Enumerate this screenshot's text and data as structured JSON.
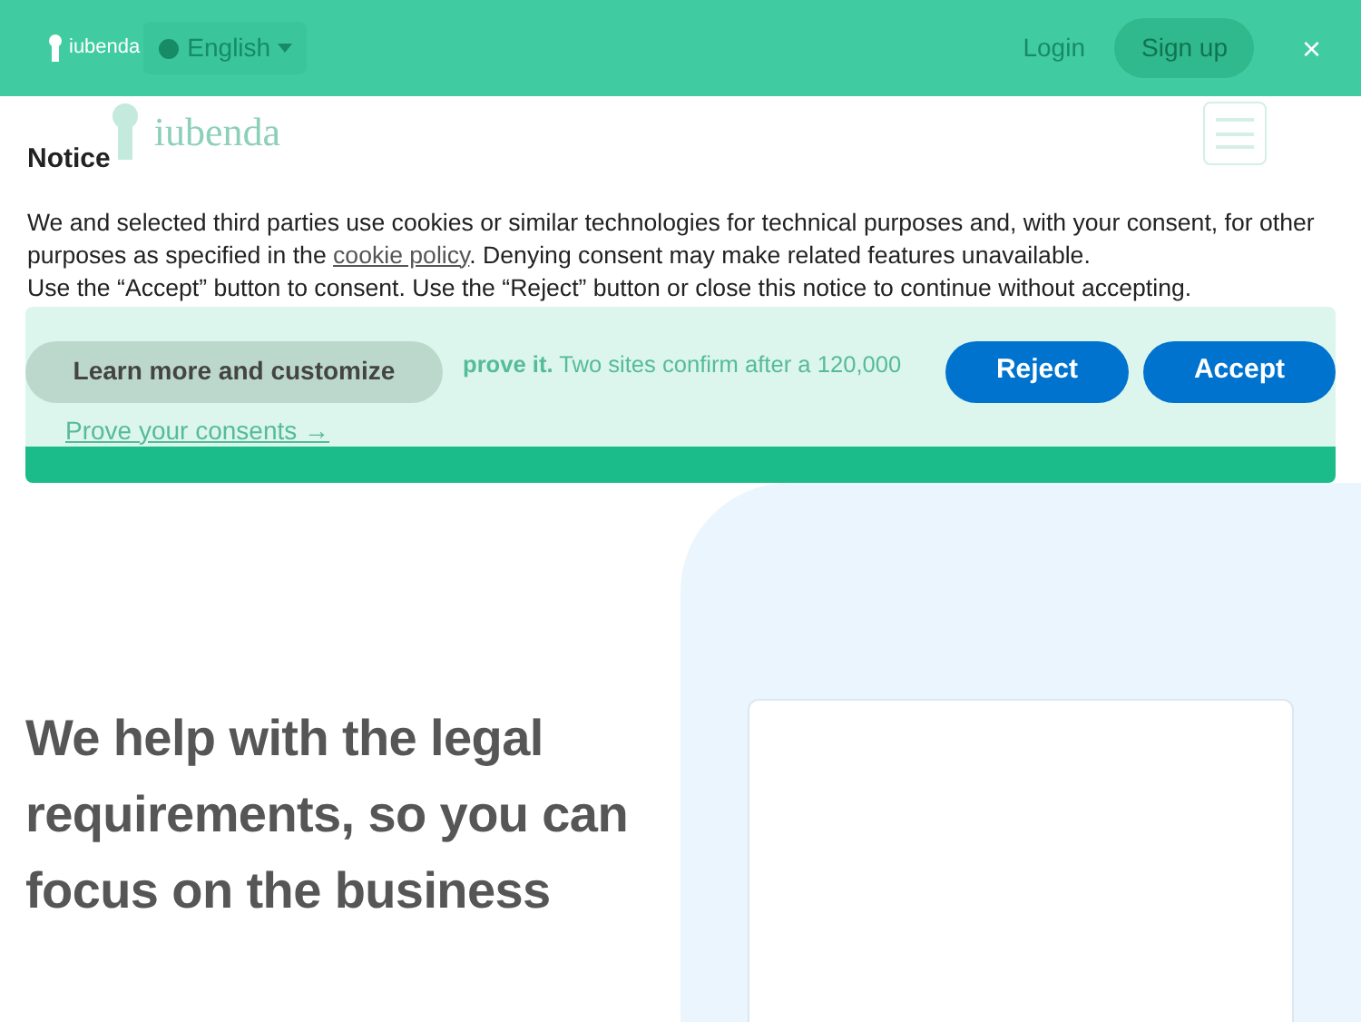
{
  "site_top_bar": {
    "language": "English",
    "login": "Login",
    "signup": "Sign up"
  },
  "site_header": {
    "logo": "iubenda"
  },
  "promo": {
    "text": "**prove it.** Two sites confirm after a 120,000",
    "link": "Prove your consents →"
  },
  "hero": {
    "heading": "We help with the legal requirements, so you can focus on the business"
  },
  "cookie_notice": {
    "logo": "iubenda",
    "close": "×",
    "title": "Notice",
    "body_before": "We and selected third parties use cookies or similar technologies for technical purposes and, with your consent, for other purposes as specified in the ",
    "policy_link": "cookie policy",
    "body_after": ". Denying consent may make related features unavailable.",
    "instruction": "Use the “Accept” button to consent. Use the “Reject” button or close this notice to continue without accepting.",
    "buttons": [
      {
        "kind": "secondary",
        "label": "Learn more and customize"
      },
      {
        "kind": "primary",
        "label": "Reject"
      },
      {
        "kind": "primary",
        "label": "Accept"
      }
    ]
  }
}
